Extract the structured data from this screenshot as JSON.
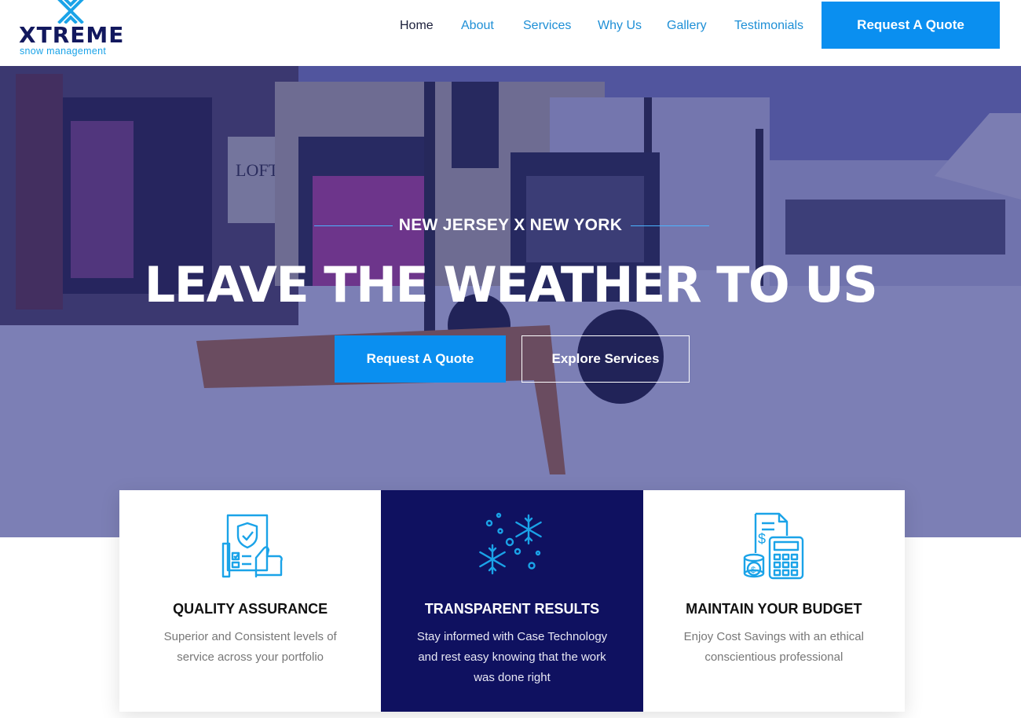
{
  "brand": {
    "name": "XTREME",
    "tagline": "snow management",
    "colors": {
      "navy": "#12185e",
      "accent": "#0a8ff0",
      "light_blue": "#1aa3e8"
    }
  },
  "nav": {
    "items": [
      {
        "label": "Home",
        "active": true
      },
      {
        "label": "About"
      },
      {
        "label": "Services"
      },
      {
        "label": "Why Us"
      },
      {
        "label": "Gallery"
      },
      {
        "label": "Testimonials"
      }
    ],
    "cta_label": "Request A Quote"
  },
  "hero": {
    "kicker": "NEW JERSEY X NEW YORK",
    "headline": "LEAVE THE WEATHER TO US",
    "primary_button": "Request A Quote",
    "secondary_button": "Explore Services"
  },
  "features": [
    {
      "icon": "quality-assurance-icon",
      "title": "QUALITY ASSURANCE",
      "text": "Superior and Consistent levels of service across your portfolio"
    },
    {
      "icon": "snowflakes-icon",
      "title": "TRANSPARENT RESULTS",
      "text": "Stay informed with Case Technology and rest easy knowing that the work was done right"
    },
    {
      "icon": "budget-calculator-icon",
      "title": "MAINTAIN YOUR BUDGET",
      "text": "Enjoy Cost Savings with an ethical conscientious professional"
    }
  ]
}
